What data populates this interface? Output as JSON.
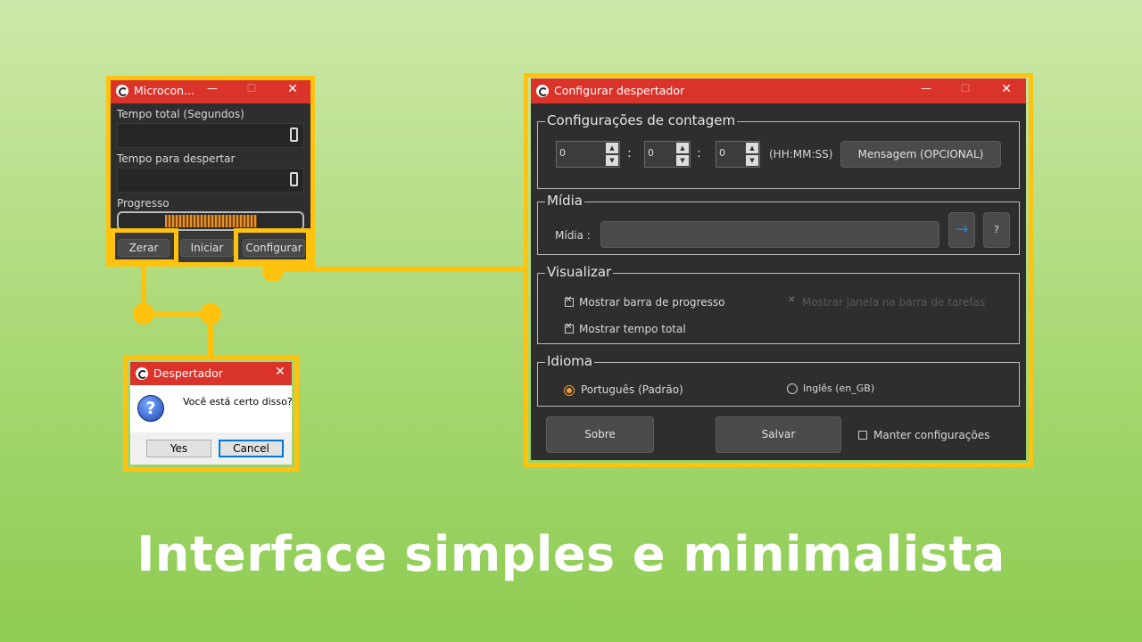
{
  "small_window": {
    "title": "Microcon...",
    "min": "—",
    "max": "☐",
    "close": "✕",
    "total_time_label": "Tempo total (Segundos)",
    "wake_time_label": "Tempo para despertar",
    "progress_label": "Progresso",
    "progress_value": 0.5,
    "buttons": {
      "reset": "Zerar",
      "start": "Iniciar",
      "configure": "Configurar"
    }
  },
  "dialog": {
    "title": "Despertador",
    "close": "✕",
    "question_icon": "?",
    "message": "Você está certo disso?",
    "yes": "Yes",
    "cancel": "Cancel"
  },
  "config_window": {
    "title": "Configurar despertador",
    "min": "—",
    "max": "☐",
    "close": "✕",
    "counting": {
      "group_title": "Configurações de contagem",
      "hours": "0",
      "minutes": "0",
      "seconds": "0",
      "sep1": ":",
      "sep2": ":",
      "format_label": "(HH:MM:SS)",
      "message_button": "Mensagem (OPCIONAL)"
    },
    "media": {
      "group_title": "Mídia",
      "label": "Mídia :",
      "path_value": "",
      "browse_icon": "→",
      "help_button": "?"
    },
    "view": {
      "group_title": "Visualizar",
      "show_progress": "Mostrar barra de progresso",
      "show_progress_checked": true,
      "show_taskbar": "Mostrar janela na barra de tarefas",
      "show_taskbar_checked": true,
      "show_taskbar_disabled": true,
      "show_total": "Mostrar tempo total",
      "show_total_checked": true
    },
    "language": {
      "group_title": "Idioma",
      "portuguese": "Português (Padrão)",
      "english": "Inglês (en_GB)",
      "selected": "portuguese"
    },
    "footer": {
      "about": "Sobre",
      "save": "Salvar",
      "keep_settings": "Manter configurações",
      "keep_settings_checked": false
    }
  },
  "caption": "Interface simples e minimalista",
  "colors": {
    "highlight": "#ffc20e",
    "titlebar": "#d9332a",
    "window_bg": "#2e2e2e",
    "progress": "#e8922a"
  }
}
